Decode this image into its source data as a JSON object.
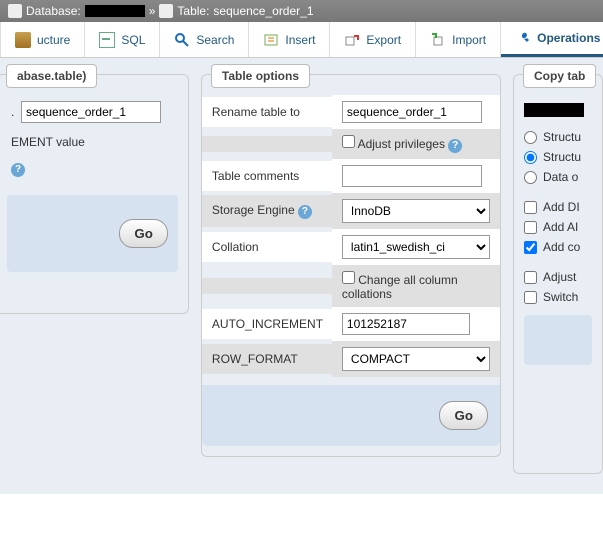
{
  "breadcrumb": {
    "db_label": "Database:",
    "table_label": "Table:",
    "table_name": "sequence_order_1"
  },
  "tabs": {
    "structure": "ucture",
    "sql": "SQL",
    "search": "Search",
    "insert": "Insert",
    "export": "Export",
    "import": "Import",
    "operations": "Operations"
  },
  "left": {
    "legend": "abase.table)",
    "dot": ".",
    "table_input": "sequence_order_1",
    "ement": "EMENT value",
    "go": "Go"
  },
  "mid": {
    "legend": "Table options",
    "rename_label": "Rename table to",
    "rename_value": "sequence_order_1",
    "adjust_priv": "Adjust privileges",
    "comments_label": "Table comments",
    "comments_value": "",
    "engine_label": "Storage Engine",
    "engine_value": "InnoDB",
    "collation_label": "Collation",
    "collation_value": "latin1_swedish_ci",
    "change_coll": "Change all column collations",
    "auto_inc_label": "AUTO_INCREMENT",
    "auto_inc_value": "101252187",
    "row_format_label": "ROW_FORMAT",
    "row_format_value": "COMPACT",
    "go": "Go"
  },
  "right": {
    "legend": "Copy tab",
    "structure1": "Structu",
    "structure2": "Structu",
    "data": "Data o",
    "add_dl": "Add DI",
    "add_al": "Add AI",
    "add_co": "Add co",
    "adjust": "Adjust",
    "switch": "Switch"
  }
}
